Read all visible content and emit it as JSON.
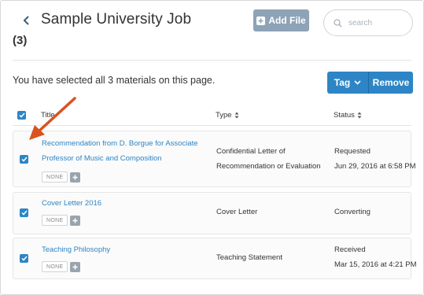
{
  "header": {
    "title": "Sample University Job",
    "count": "(3)",
    "add_file_label": "Add File",
    "search_placeholder": "search"
  },
  "selection": {
    "message": "You have selected all 3 materials on this page.",
    "tag_label": "Tag",
    "remove_label": "Remove"
  },
  "table": {
    "columns": {
      "title": "Title",
      "type": "Type",
      "status": "Status"
    },
    "rows": [
      {
        "title_line1": "Recommendation from D. Borgue for Associate",
        "title_line2": "Professor of Music and Composition",
        "tag": "NONE",
        "type_line1": "Confidential Letter of",
        "type_line2": "Recommendation or Evaluation",
        "status": "Requested",
        "date": "Jun 29, 2016 at 6:58 PM"
      },
      {
        "title_line1": "Cover Letter 2016",
        "tag": "NONE",
        "type_line1": "Cover Letter",
        "status": "Converting"
      },
      {
        "title_line1": "Teaching Philosophy",
        "tag": "NONE",
        "type_line1": "Teaching Statement",
        "status": "Received",
        "date": "Mar 15, 2016 at 4:21 PM"
      }
    ]
  },
  "colors": {
    "accent": "#2d85c5",
    "add_file_bg": "#8ea3b6",
    "annotation_arrow": "#d9531e"
  },
  "icons": [
    "chevron-left-icon",
    "plus-icon",
    "search-icon",
    "chevron-down-icon",
    "sort-icon",
    "check-icon"
  ]
}
